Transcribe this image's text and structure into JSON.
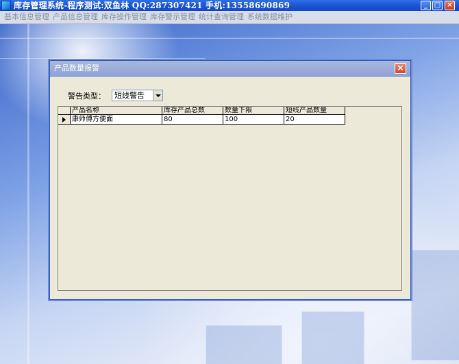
{
  "window": {
    "title": "库存管理系统-程序测试:双鱼林 QQ:287307421 手机:13558690869",
    "controls": {
      "minimize": "_",
      "maximize": "□",
      "close": "×"
    }
  },
  "menu": {
    "items": [
      {
        "label": "基本信息管理"
      },
      {
        "label": "产品信息管理"
      },
      {
        "label": "库存操作管理"
      },
      {
        "label": "库存警示管理"
      },
      {
        "label": "统计查询管理"
      },
      {
        "label": "系统数据维护"
      }
    ]
  },
  "dialog": {
    "title": "产品数量报警",
    "close": "×",
    "warning_type": {
      "label": "警告类型：",
      "value": "短线警告"
    },
    "table": {
      "columns": [
        "产品名称",
        "库存产品总数",
        "数量下限",
        "短线产品数量"
      ],
      "rows": [
        [
          "康师傅方便面",
          "80",
          "100",
          "20"
        ]
      ]
    }
  },
  "colors": {
    "titlebar": "#1b55d6",
    "menubar": "#d8ddea",
    "dialog_bg": "#ece9d8",
    "dialog_title": "#8ea3d6"
  }
}
